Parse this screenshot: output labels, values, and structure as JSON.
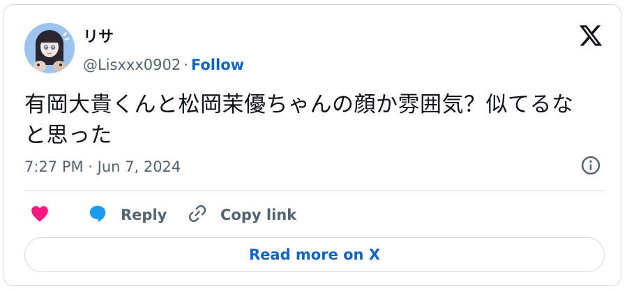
{
  "author": {
    "display_name": "リサ",
    "handle": "@Lisxxx0902",
    "separator": "·",
    "follow_label": "Follow"
  },
  "tweet": {
    "text_line1": "有岡大貴くんと松岡茉優ちゃんの顔か雰囲気？似てるな",
    "text_line2": "と思った",
    "timestamp": "7:27 PM · Jun 7, 2024"
  },
  "actions": {
    "like_label": "",
    "reply_label": "Reply",
    "copy_link_label": "Copy link"
  },
  "read_more_label": "Read more on X",
  "colors": {
    "link_blue": "#0f63c5",
    "like_pink": "#f91880",
    "reply_blue": "#1d9bf0",
    "muted_text": "#536471",
    "border": "#cfd9de"
  },
  "icons": {
    "brand": "x-logo-icon",
    "info": "info-icon",
    "like": "heart-icon",
    "reply": "speech-bubble-icon",
    "copy_link": "link-icon"
  }
}
